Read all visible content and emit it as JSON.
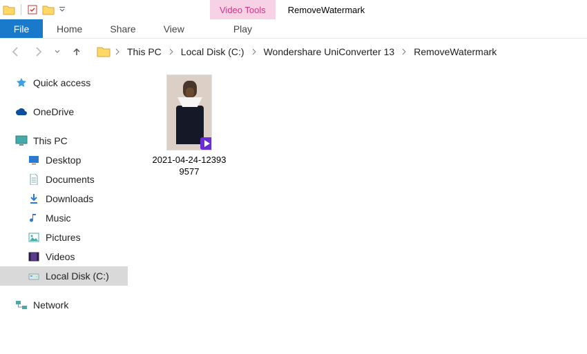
{
  "window": {
    "title": "RemoveWatermark",
    "tool_tab": "Video Tools"
  },
  "ribbon": {
    "file": "File",
    "tabs": [
      "Home",
      "Share",
      "View"
    ],
    "tool_tabs": [
      "Play"
    ]
  },
  "breadcrumbs": [
    "This PC",
    "Local Disk (C:)",
    "Wondershare UniConverter 13",
    "RemoveWatermark"
  ],
  "sidebar": {
    "quick_access": "Quick access",
    "onedrive": "OneDrive",
    "this_pc": "This PC",
    "this_pc_children": [
      {
        "icon": "desktop-icon",
        "label": "Desktop"
      },
      {
        "icon": "documents-icon",
        "label": "Documents"
      },
      {
        "icon": "downloads-icon",
        "label": "Downloads"
      },
      {
        "icon": "music-icon",
        "label": "Music"
      },
      {
        "icon": "pictures-icon",
        "label": "Pictures"
      },
      {
        "icon": "videos-icon",
        "label": "Videos"
      },
      {
        "icon": "disk-icon",
        "label": "Local Disk (C:)"
      }
    ],
    "network": "Network"
  },
  "files": [
    {
      "name_line1": "2021-04-24-12393",
      "name_line2": "9577"
    }
  ]
}
